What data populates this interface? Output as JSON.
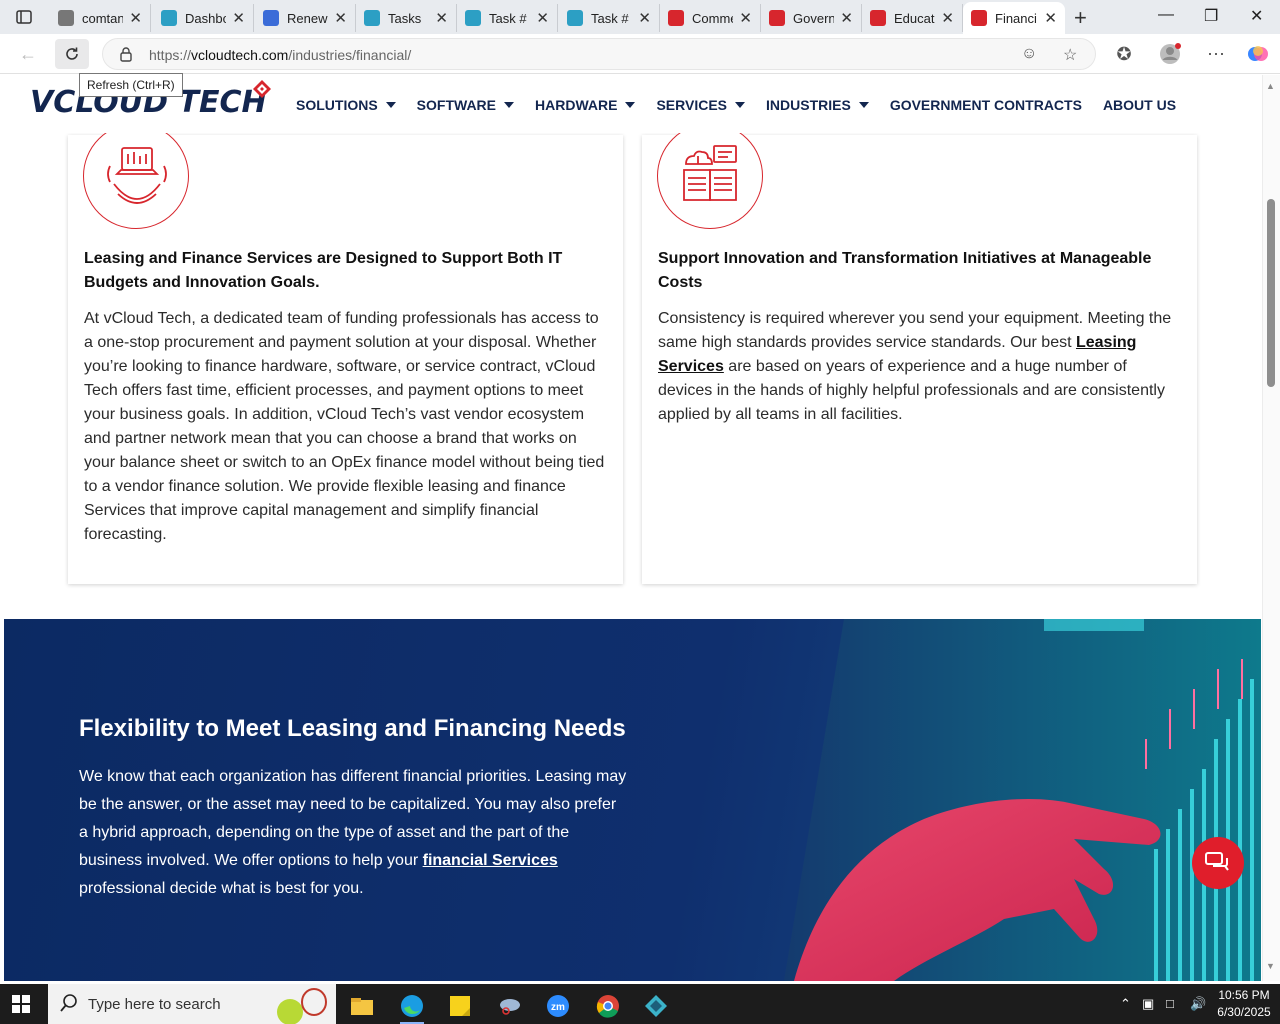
{
  "browser": {
    "tabs": [
      {
        "title": "comtan",
        "color": "#777777"
      },
      {
        "title": "Dashbo",
        "color": "#2c9fc4"
      },
      {
        "title": "Renewi",
        "color": "#3b6cd8"
      },
      {
        "title": "Tasks",
        "color": "#2c9fc4"
      },
      {
        "title": "Task # C",
        "color": "#2c9fc4"
      },
      {
        "title": "Task # C",
        "color": "#2c9fc4"
      },
      {
        "title": "Comme",
        "color": "#d7262d"
      },
      {
        "title": "Govern",
        "color": "#d7262d"
      },
      {
        "title": "Educati",
        "color": "#d7262d"
      },
      {
        "title": "Financi",
        "color": "#d7262d"
      }
    ],
    "url_prefix": "https://",
    "url_domain": "vcloudtech.com",
    "url_path": "/industries/financial/",
    "tooltip": "Refresh (Ctrl+R)"
  },
  "site": {
    "logo_part1": "VCLOUD",
    "logo_part2": " TECH",
    "nav": [
      {
        "label": "SOLUTIONS",
        "dropdown": true
      },
      {
        "label": "SOFTWARE",
        "dropdown": true
      },
      {
        "label": "HARDWARE",
        "dropdown": true
      },
      {
        "label": "SERVICES",
        "dropdown": true
      },
      {
        "label": "INDUSTRIES",
        "dropdown": true
      },
      {
        "label": "GOVERNMENT CONTRACTS",
        "dropdown": false
      },
      {
        "label": "ABOUT US",
        "dropdown": false
      }
    ]
  },
  "cards": {
    "left": {
      "icon": "globe-laptop-icon",
      "title": "Leasing and Finance Services are Designed to Support Both IT Budgets and Innovation Goals.",
      "body": "At vCloud Tech, a dedicated team of funding professionals has access to a one-stop procurement and payment solution at your disposal. Whether you’re looking to finance hardware, software, or service contract, vCloud Tech offers fast time, efficient processes, and payment options to meet your business goals. In addition, vCloud Tech’s vast vendor ecosystem and partner network mean that you can choose a brand that works on your balance sheet or switch to an OpEx finance model without being tied to a vendor finance solution. We provide flexible leasing and finance Services that improve capital management and simplify financial forecasting."
    },
    "right": {
      "icon": "book-cloud-icon",
      "title": "Support Innovation and Transformation Initiatives at Manageable Costs",
      "body_before": "Consistency is required wherever you send your equipment. Meeting the same high standards provides service standards. Our best ",
      "body_link": "Leasing Services",
      "body_after": " are based on years of experience and a huge number of devices in the hands of highly helpful professionals and are consistently applied by all teams in all facilities."
    }
  },
  "banner": {
    "title": "Flexibility to Meet Leasing and Financing Needs",
    "body_before": "We know that each organization has different financial priorities. Leasing may be the answer, or the asset may need to be capitalized. You may also prefer a hybrid approach, depending on the type of asset and the part of the business involved. We offer options to help your ",
    "body_link": "financial Services",
    "body_after": " professional decide what is best for you."
  },
  "taskbar": {
    "search_placeholder": "Type here to search",
    "time": "10:56 PM",
    "date": "6/30/2025"
  },
  "colors": {
    "brand_navy": "#13264f",
    "brand_red": "#d7262d"
  }
}
